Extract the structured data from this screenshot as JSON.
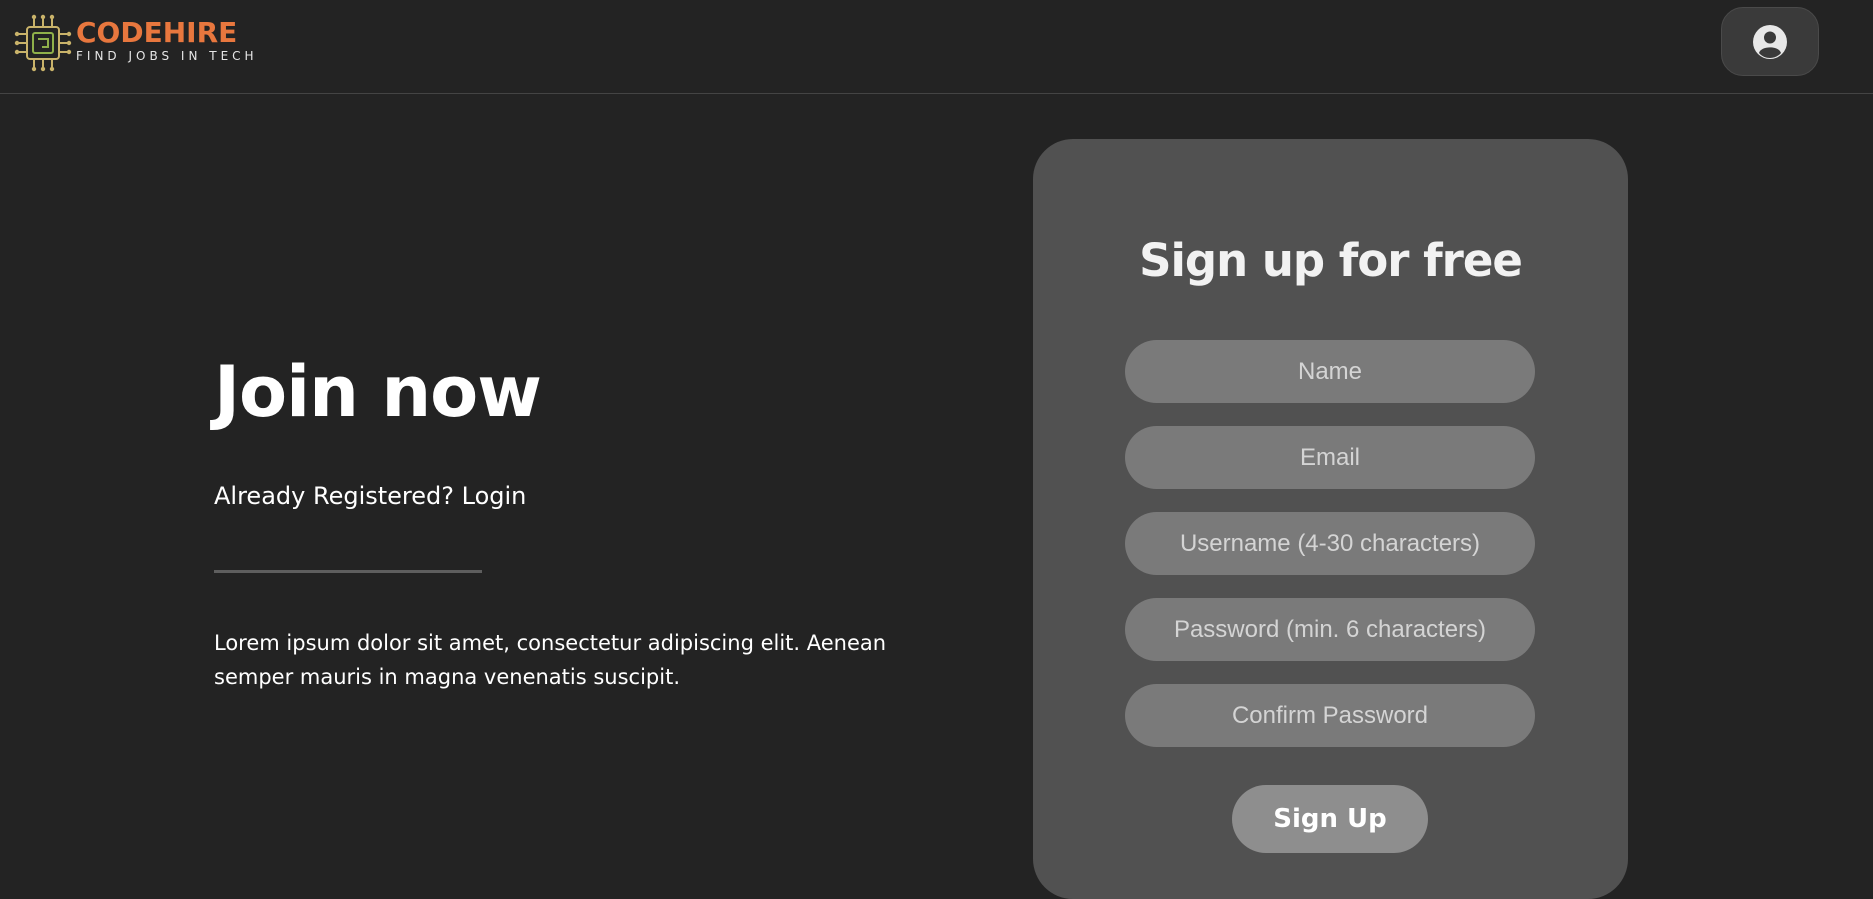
{
  "header": {
    "logo": {
      "name": "CODEHIRE",
      "tagline": "FIND JOBS IN TECH",
      "icon": "circuit-chip-icon"
    },
    "account_icon": "user-circle-icon"
  },
  "hero": {
    "title": "Join now",
    "already_text": "Already Registered?",
    "login_label": "Login",
    "description": "Lorem ipsum dolor sit amet, consectetur adipiscing elit. Aenean semper mauris in magna venenatis suscipit."
  },
  "signup": {
    "title": "Sign up for free",
    "fields": {
      "name_placeholder": "Name",
      "email_placeholder": "Email",
      "username_placeholder": "Username (4-30 characters)",
      "password_placeholder": "Password (min. 6 characters)",
      "confirm_placeholder": "Confirm Password"
    },
    "button_label": "Sign Up"
  },
  "colors": {
    "background": "#232323",
    "brand_orange": "#e8773e",
    "card": "#515151",
    "field": "#7a7a7a",
    "button": "#8e8e8e"
  }
}
